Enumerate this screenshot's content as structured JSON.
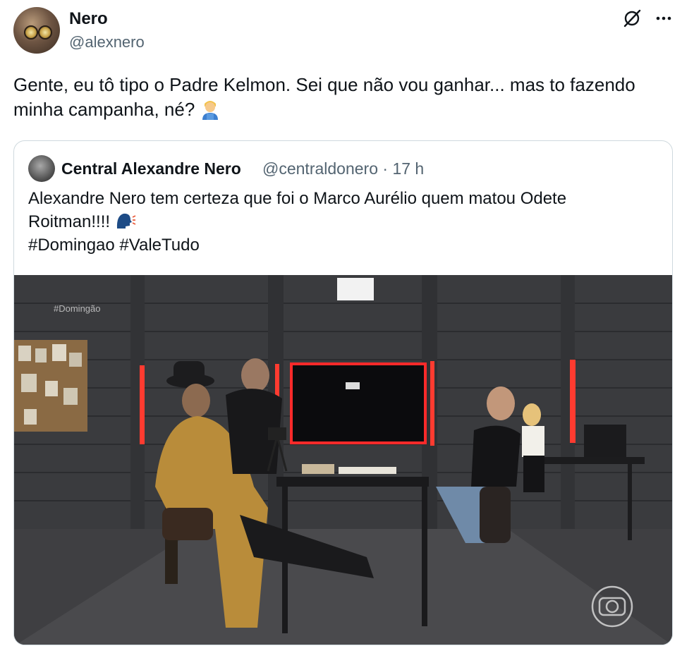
{
  "author": {
    "name": "Nero",
    "handle": "@alexnero"
  },
  "tweet": {
    "text": "Gente, eu tô tipo o Padre Kelmon. Sei que não vou ganhar... mas to fazendo minha campanha, né?",
    "emoji": "person-emoji"
  },
  "quoted": {
    "name": "Central Alexandre Nero",
    "handle": "@centraldonero",
    "separator": "·",
    "time": "17 h",
    "line1": "Alexandre Nero tem certeza que foi o Marco Aurélio quem matou Odete",
    "line2": "Roitman!!!!",
    "line3": "#Domingao #ValeTudo",
    "video_tag": "#Domingão"
  },
  "icons": {
    "grok": "grok-icon",
    "more": "more-icon"
  },
  "colors": {
    "text": "#0f1419",
    "secondary": "#536471",
    "border": "#cfd9de",
    "neon": "#ff2a2a"
  }
}
